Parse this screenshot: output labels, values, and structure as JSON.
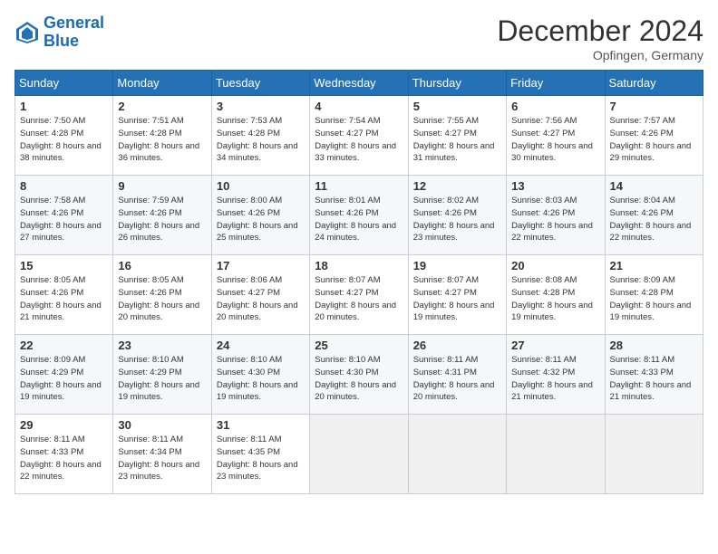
{
  "header": {
    "logo_line1": "General",
    "logo_line2": "Blue",
    "month": "December 2024",
    "location": "Opfingen, Germany"
  },
  "weekdays": [
    "Sunday",
    "Monday",
    "Tuesday",
    "Wednesday",
    "Thursday",
    "Friday",
    "Saturday"
  ],
  "weeks": [
    [
      {
        "day": "1",
        "detail": "Sunrise: 7:50 AM\nSunset: 4:28 PM\nDaylight: 8 hours\nand 38 minutes."
      },
      {
        "day": "2",
        "detail": "Sunrise: 7:51 AM\nSunset: 4:28 PM\nDaylight: 8 hours\nand 36 minutes."
      },
      {
        "day": "3",
        "detail": "Sunrise: 7:53 AM\nSunset: 4:28 PM\nDaylight: 8 hours\nand 34 minutes."
      },
      {
        "day": "4",
        "detail": "Sunrise: 7:54 AM\nSunset: 4:27 PM\nDaylight: 8 hours\nand 33 minutes."
      },
      {
        "day": "5",
        "detail": "Sunrise: 7:55 AM\nSunset: 4:27 PM\nDaylight: 8 hours\nand 31 minutes."
      },
      {
        "day": "6",
        "detail": "Sunrise: 7:56 AM\nSunset: 4:27 PM\nDaylight: 8 hours\nand 30 minutes."
      },
      {
        "day": "7",
        "detail": "Sunrise: 7:57 AM\nSunset: 4:26 PM\nDaylight: 8 hours\nand 29 minutes."
      }
    ],
    [
      {
        "day": "8",
        "detail": "Sunrise: 7:58 AM\nSunset: 4:26 PM\nDaylight: 8 hours\nand 27 minutes."
      },
      {
        "day": "9",
        "detail": "Sunrise: 7:59 AM\nSunset: 4:26 PM\nDaylight: 8 hours\nand 26 minutes."
      },
      {
        "day": "10",
        "detail": "Sunrise: 8:00 AM\nSunset: 4:26 PM\nDaylight: 8 hours\nand 25 minutes."
      },
      {
        "day": "11",
        "detail": "Sunrise: 8:01 AM\nSunset: 4:26 PM\nDaylight: 8 hours\nand 24 minutes."
      },
      {
        "day": "12",
        "detail": "Sunrise: 8:02 AM\nSunset: 4:26 PM\nDaylight: 8 hours\nand 23 minutes."
      },
      {
        "day": "13",
        "detail": "Sunrise: 8:03 AM\nSunset: 4:26 PM\nDaylight: 8 hours\nand 22 minutes."
      },
      {
        "day": "14",
        "detail": "Sunrise: 8:04 AM\nSunset: 4:26 PM\nDaylight: 8 hours\nand 22 minutes."
      }
    ],
    [
      {
        "day": "15",
        "detail": "Sunrise: 8:05 AM\nSunset: 4:26 PM\nDaylight: 8 hours\nand 21 minutes."
      },
      {
        "day": "16",
        "detail": "Sunrise: 8:05 AM\nSunset: 4:26 PM\nDaylight: 8 hours\nand 20 minutes."
      },
      {
        "day": "17",
        "detail": "Sunrise: 8:06 AM\nSunset: 4:27 PM\nDaylight: 8 hours\nand 20 minutes."
      },
      {
        "day": "18",
        "detail": "Sunrise: 8:07 AM\nSunset: 4:27 PM\nDaylight: 8 hours\nand 20 minutes."
      },
      {
        "day": "19",
        "detail": "Sunrise: 8:07 AM\nSunset: 4:27 PM\nDaylight: 8 hours\nand 19 minutes."
      },
      {
        "day": "20",
        "detail": "Sunrise: 8:08 AM\nSunset: 4:28 PM\nDaylight: 8 hours\nand 19 minutes."
      },
      {
        "day": "21",
        "detail": "Sunrise: 8:09 AM\nSunset: 4:28 PM\nDaylight: 8 hours\nand 19 minutes."
      }
    ],
    [
      {
        "day": "22",
        "detail": "Sunrise: 8:09 AM\nSunset: 4:29 PM\nDaylight: 8 hours\nand 19 minutes."
      },
      {
        "day": "23",
        "detail": "Sunrise: 8:10 AM\nSunset: 4:29 PM\nDaylight: 8 hours\nand 19 minutes."
      },
      {
        "day": "24",
        "detail": "Sunrise: 8:10 AM\nSunset: 4:30 PM\nDaylight: 8 hours\nand 19 minutes."
      },
      {
        "day": "25",
        "detail": "Sunrise: 8:10 AM\nSunset: 4:30 PM\nDaylight: 8 hours\nand 20 minutes."
      },
      {
        "day": "26",
        "detail": "Sunrise: 8:11 AM\nSunset: 4:31 PM\nDaylight: 8 hours\nand 20 minutes."
      },
      {
        "day": "27",
        "detail": "Sunrise: 8:11 AM\nSunset: 4:32 PM\nDaylight: 8 hours\nand 21 minutes."
      },
      {
        "day": "28",
        "detail": "Sunrise: 8:11 AM\nSunset: 4:33 PM\nDaylight: 8 hours\nand 21 minutes."
      }
    ],
    [
      {
        "day": "29",
        "detail": "Sunrise: 8:11 AM\nSunset: 4:33 PM\nDaylight: 8 hours\nand 22 minutes."
      },
      {
        "day": "30",
        "detail": "Sunrise: 8:11 AM\nSunset: 4:34 PM\nDaylight: 8 hours\nand 23 minutes."
      },
      {
        "day": "31",
        "detail": "Sunrise: 8:11 AM\nSunset: 4:35 PM\nDaylight: 8 hours\nand 23 minutes."
      },
      null,
      null,
      null,
      null
    ]
  ]
}
